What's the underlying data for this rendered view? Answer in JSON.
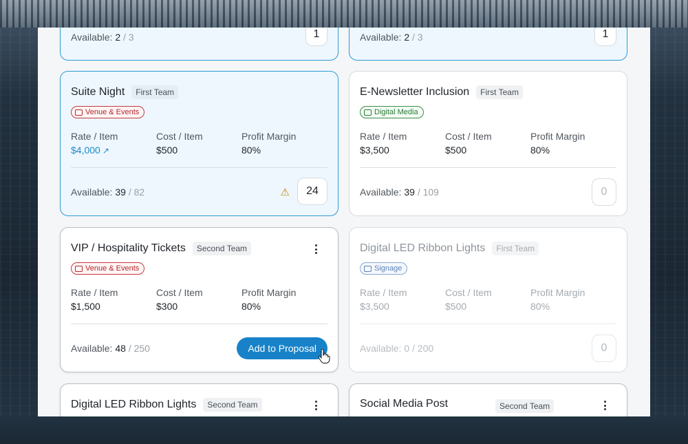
{
  "cards": [
    {
      "available": "2",
      "total": "/ 3",
      "qty": "1"
    },
    {
      "available": "2",
      "total": "/ 3",
      "qty": "1"
    },
    {
      "title": "Suite Night",
      "team": "First Team",
      "category": "Venue & Events",
      "rate_label": "Rate / Item",
      "rate": "$4,000",
      "cost_label": "Cost / Item",
      "cost": "$500",
      "margin_label": "Profit Margin",
      "margin": "80%",
      "available_label": "Available:",
      "available": "39",
      "total": "/ 82",
      "qty": "24"
    },
    {
      "title": "E-Newsletter Inclusion",
      "team": "First Team",
      "category": "Digital Media",
      "rate_label": "Rate / Item",
      "rate": "$3,500",
      "cost_label": "Cost / Item",
      "cost": "$500",
      "margin_label": "Profit Margin",
      "margin": "80%",
      "available_label": "Available:",
      "available": "39",
      "total": "/ 109",
      "qty": "0"
    },
    {
      "title": "VIP / Hospitality Tickets",
      "team": "Second Team",
      "category": "Venue & Events",
      "rate_label": "Rate / Item",
      "rate": "$1,500",
      "cost_label": "Cost / Item",
      "cost": "$300",
      "margin_label": "Profit Margin",
      "margin": "80%",
      "available_label": "Available:",
      "available": "48",
      "total": "/ 250",
      "button": "Add to Proposal"
    },
    {
      "title": "Digital LED Ribbon Lights",
      "team": "First Team",
      "category": "Signage",
      "rate_label": "Rate / Item",
      "rate": "$3,500",
      "cost_label": "Cost / Item",
      "cost": "$500",
      "margin_label": "Profit Margin",
      "margin": "80%",
      "available_label": "Available:",
      "available": "0",
      "total": "/ 200",
      "qty": "0"
    },
    {
      "title": "Digital LED Ribbon Lights",
      "team": "Second Team"
    },
    {
      "title": "Social Media Post",
      "team": "Second Team"
    }
  ],
  "colors": {
    "accent": "#1882c9",
    "selected_border": "#2b9ad6",
    "venue": "#b3262b",
    "digital": "#2c7a37",
    "signage": "#5d82b8",
    "warning": "#c88a12"
  }
}
